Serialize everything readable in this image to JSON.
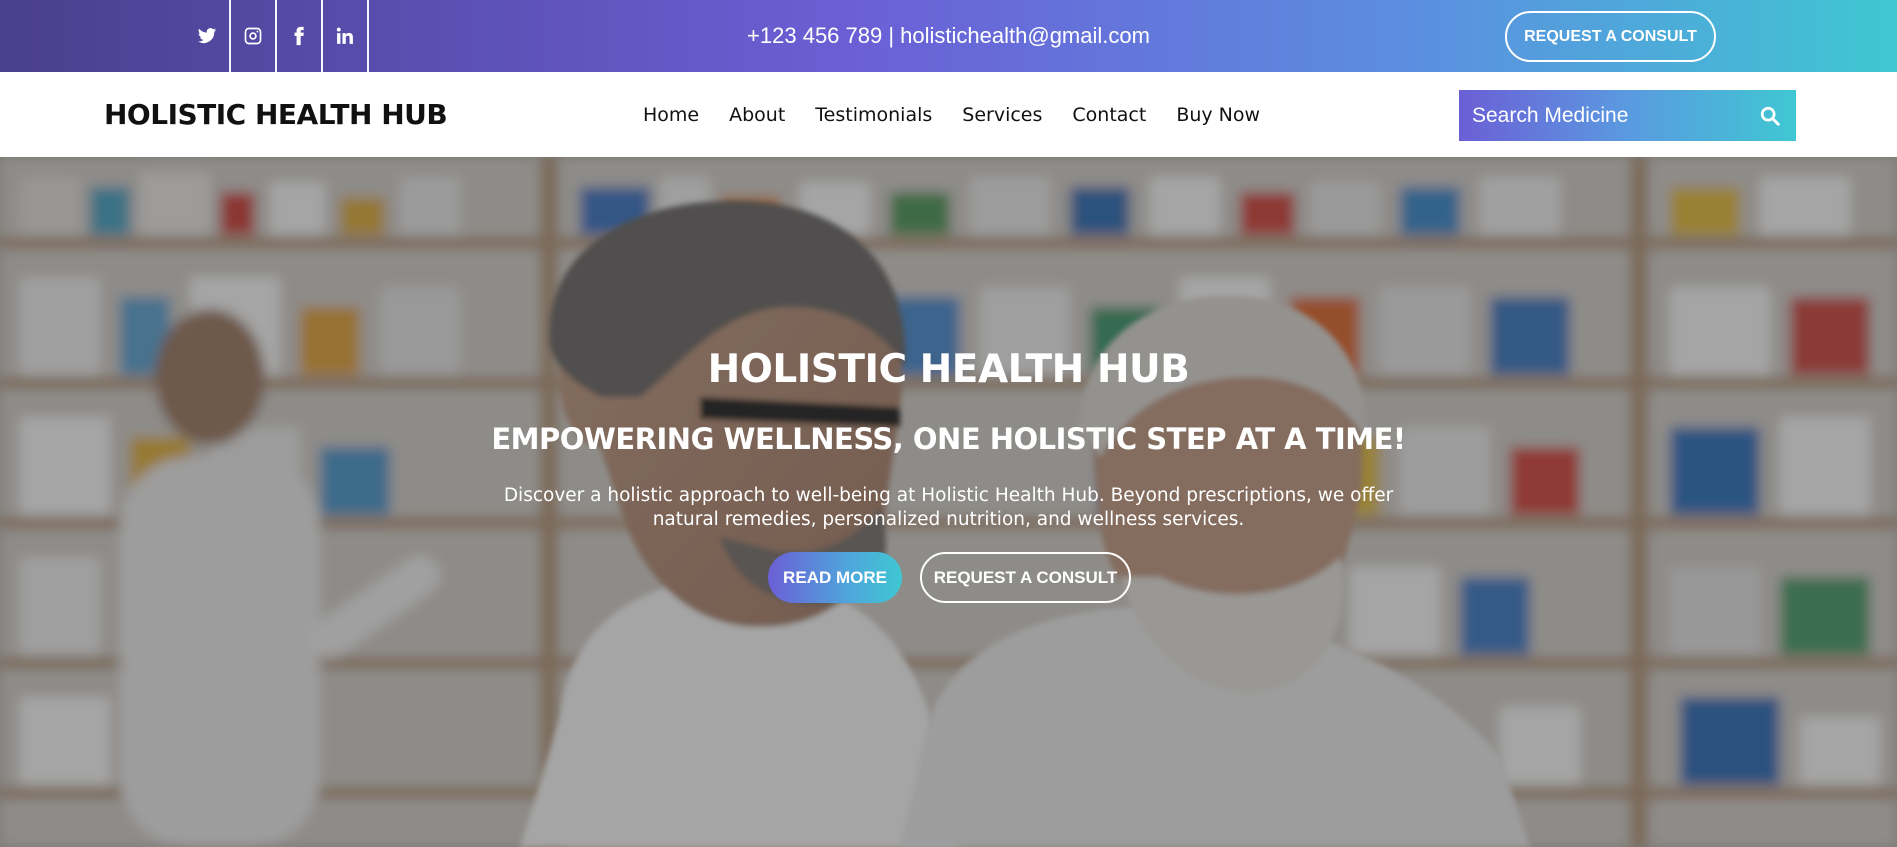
{
  "colors": {
    "gradient_start": "#4a3f8c",
    "gradient_mid": "#6b5fd6",
    "gradient_end": "#3fc7d2",
    "text_dark": "#111111",
    "white": "#ffffff"
  },
  "topbar": {
    "socials": [
      {
        "icon": "twitter-icon"
      },
      {
        "icon": "instagram-icon"
      },
      {
        "icon": "facebook-icon"
      },
      {
        "icon": "linkedin-icon"
      }
    ],
    "contact": "+123 456 789 | holistichealth@gmail.com",
    "consult_label": "REQUEST A CONSULT"
  },
  "navbar": {
    "brand": "HOLISTIC HEALTH HUB",
    "links": [
      "Home",
      "About",
      "Testimonials",
      "Services",
      "Contact",
      "Buy Now"
    ],
    "search": {
      "placeholder": "Search Medicine",
      "icon": "search-icon"
    }
  },
  "hero": {
    "title": "HOLISTIC HEALTH HUB",
    "subtitle": "EMPOWERING WELLNESS, ONE HOLISTIC STEP AT A TIME!",
    "description": "Discover a holistic approach to well-being at Holistic Health Hub. Beyond prescriptions, we offer natural remedies, personalized nutrition, and wellness services.",
    "read_more_label": "READ MORE",
    "consult_label": "REQUEST A CONSULT",
    "background": "pharmacy-photo"
  }
}
